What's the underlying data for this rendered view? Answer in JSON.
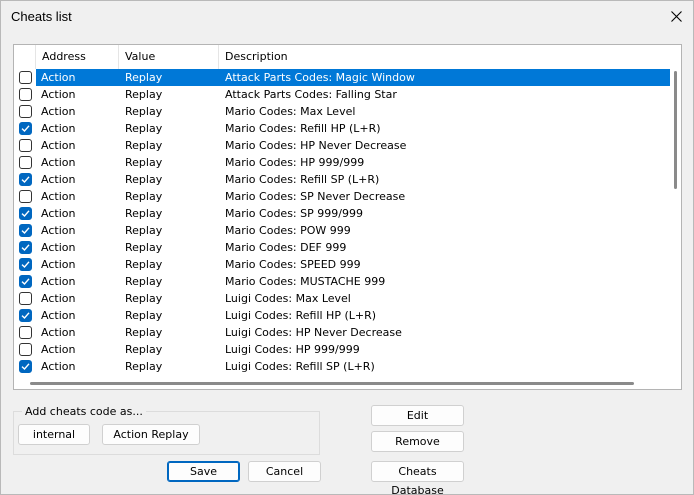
{
  "window": {
    "title": "Cheats list"
  },
  "list": {
    "columns": [
      "Address",
      "Value",
      "Description"
    ],
    "rows": [
      {
        "checked": false,
        "address": "Action",
        "value": "Replay",
        "description": "Attack Parts Codes: Magic Window",
        "selected": true
      },
      {
        "checked": false,
        "address": "Action",
        "value": "Replay",
        "description": "Attack Parts Codes: Falling Star"
      },
      {
        "checked": false,
        "address": "Action",
        "value": "Replay",
        "description": "Mario Codes: Max Level"
      },
      {
        "checked": true,
        "address": "Action",
        "value": "Replay",
        "description": "Mario Codes: Refill HP (L+R)"
      },
      {
        "checked": false,
        "address": "Action",
        "value": "Replay",
        "description": "Mario Codes: HP Never Decrease"
      },
      {
        "checked": false,
        "address": "Action",
        "value": "Replay",
        "description": "Mario Codes: HP 999/999"
      },
      {
        "checked": true,
        "address": "Action",
        "value": "Replay",
        "description": "Mario Codes: Refill SP (L+R)"
      },
      {
        "checked": false,
        "address": "Action",
        "value": "Replay",
        "description": "Mario Codes: SP Never Decrease"
      },
      {
        "checked": true,
        "address": "Action",
        "value": "Replay",
        "description": "Mario Codes: SP 999/999"
      },
      {
        "checked": true,
        "address": "Action",
        "value": "Replay",
        "description": "Mario Codes: POW 999"
      },
      {
        "checked": true,
        "address": "Action",
        "value": "Replay",
        "description": "Mario Codes: DEF 999"
      },
      {
        "checked": true,
        "address": "Action",
        "value": "Replay",
        "description": "Mario Codes: SPEED 999"
      },
      {
        "checked": true,
        "address": "Action",
        "value": "Replay",
        "description": "Mario Codes: MUSTACHE 999"
      },
      {
        "checked": false,
        "address": "Action",
        "value": "Replay",
        "description": "Luigi Codes: Max Level"
      },
      {
        "checked": true,
        "address": "Action",
        "value": "Replay",
        "description": "Luigi Codes: Refill HP (L+R)"
      },
      {
        "checked": false,
        "address": "Action",
        "value": "Replay",
        "description": "Luigi Codes: HP Never Decrease"
      },
      {
        "checked": false,
        "address": "Action",
        "value": "Replay",
        "description": "Luigi Codes: HP 999/999"
      },
      {
        "checked": true,
        "address": "Action",
        "value": "Replay",
        "description": "Luigi Codes: Refill SP (L+R)"
      }
    ]
  },
  "add_group": {
    "label": "Add cheats code as...",
    "internal_label": "internal",
    "action_replay_label": "Action Replay"
  },
  "buttons": {
    "save": "Save",
    "cancel": "Cancel",
    "edit": "Edit",
    "remove": "Remove",
    "cheats_database": "Cheats Database"
  },
  "colors": {
    "selection": "#0078d7",
    "checkbox_on": "#0067c0"
  }
}
